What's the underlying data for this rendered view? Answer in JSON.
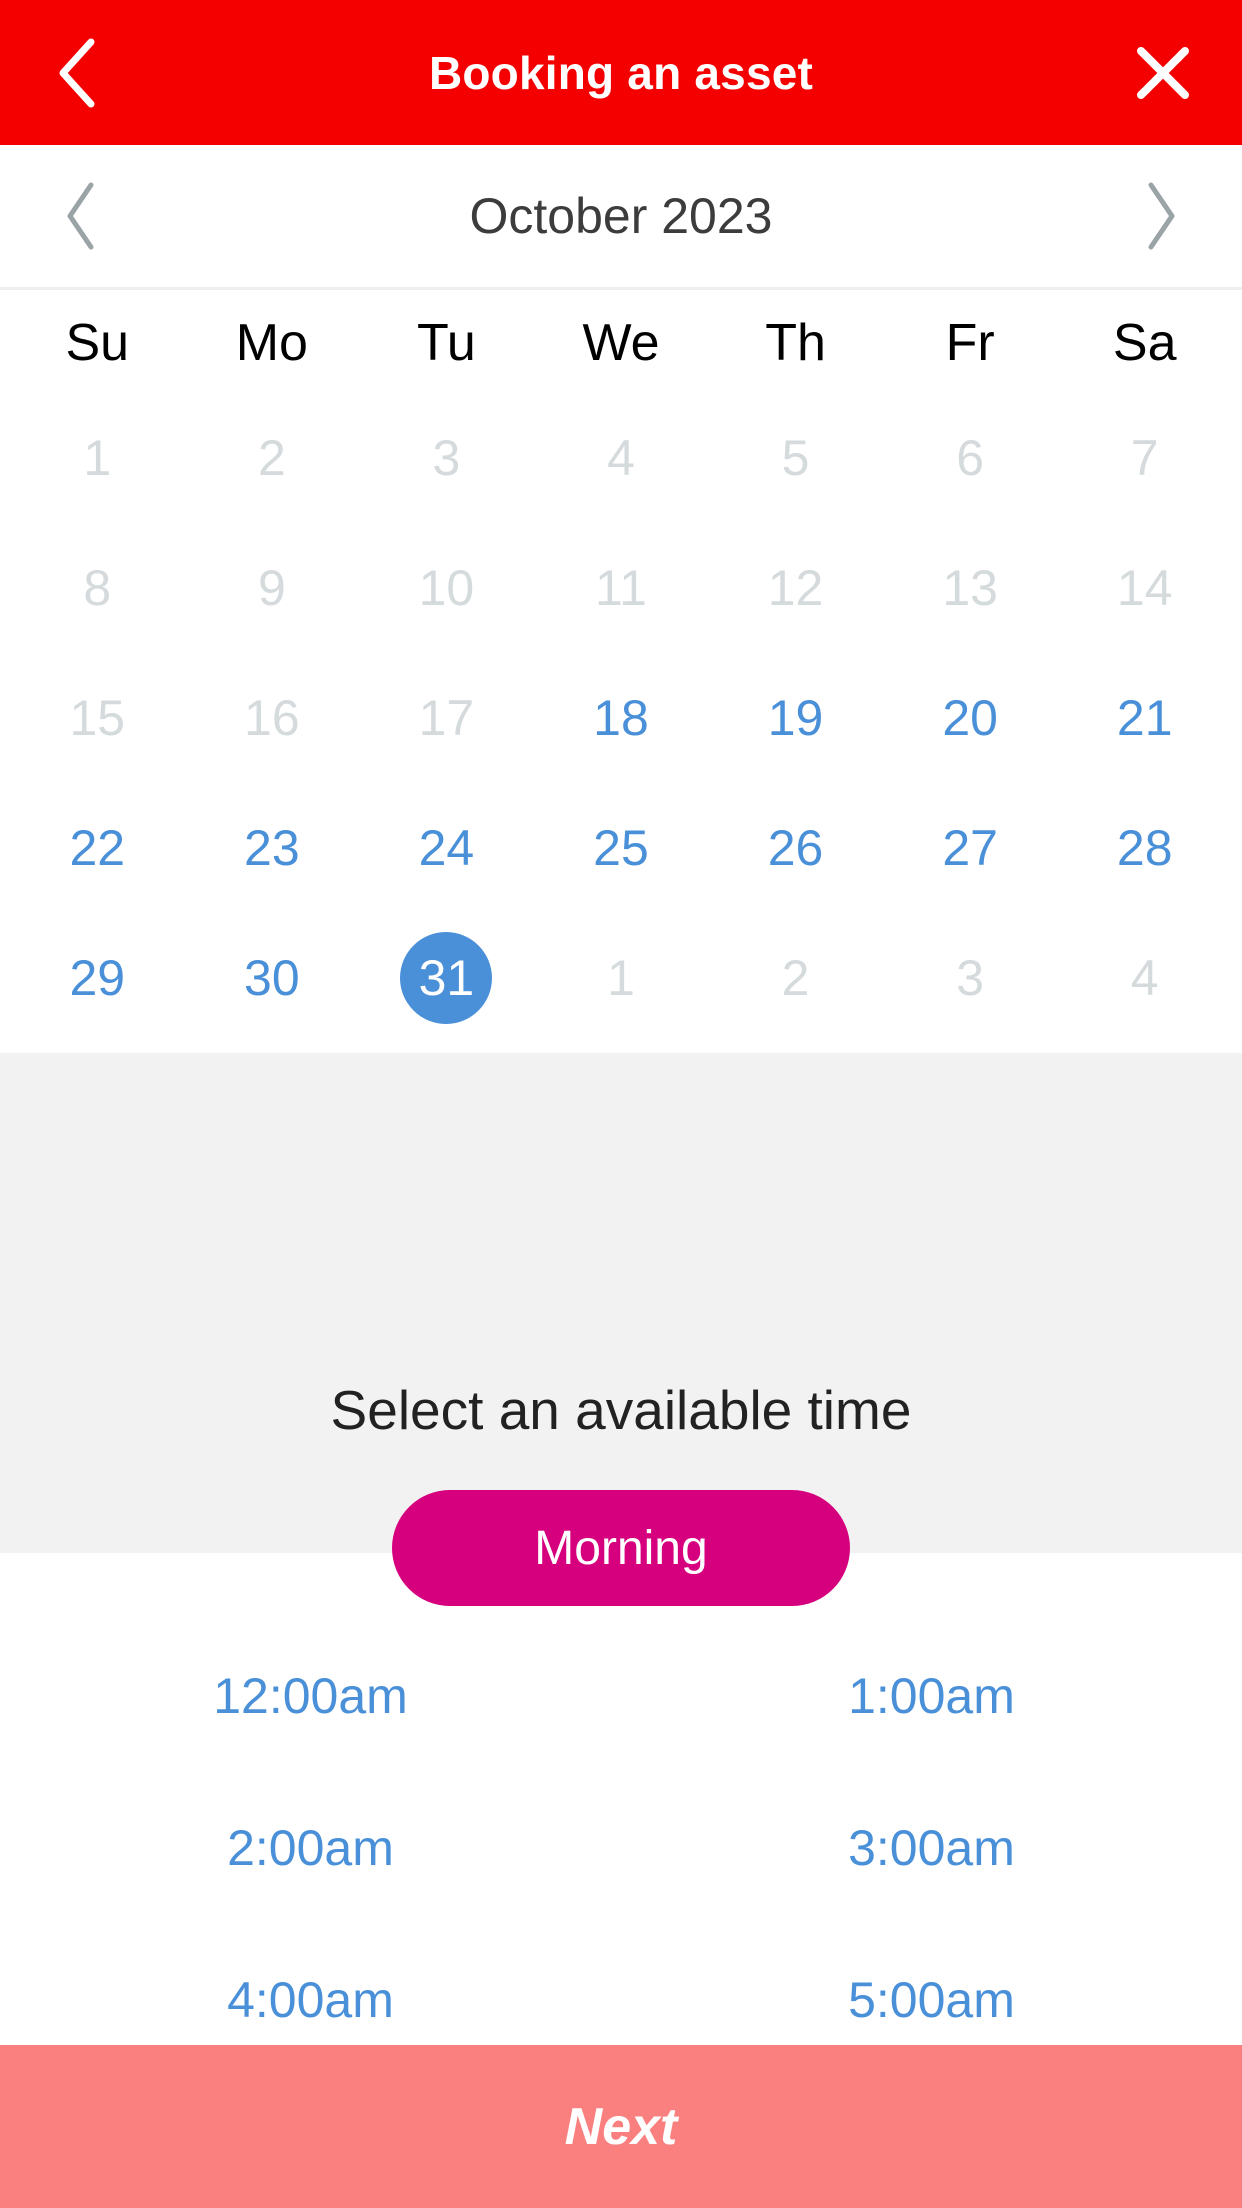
{
  "header": {
    "title": "Booking an asset",
    "back_icon": "chevron-left-icon",
    "close_icon": "close-icon",
    "background_color": "#f50000"
  },
  "month_nav": {
    "label": "October 2023",
    "prev_icon": "chevron-left-icon",
    "next_icon": "chevron-right-icon"
  },
  "calendar": {
    "weekdays": [
      "Su",
      "Mo",
      "Tu",
      "We",
      "Th",
      "Fr",
      "Sa"
    ],
    "selected_day": "31",
    "accent_color": "#4a90d9",
    "disabled_color": "#d5dadc",
    "weeks": [
      [
        {
          "label": "1",
          "state": "disabled"
        },
        {
          "label": "2",
          "state": "disabled"
        },
        {
          "label": "3",
          "state": "disabled"
        },
        {
          "label": "4",
          "state": "disabled"
        },
        {
          "label": "5",
          "state": "disabled"
        },
        {
          "label": "6",
          "state": "disabled"
        },
        {
          "label": "7",
          "state": "disabled"
        }
      ],
      [
        {
          "label": "8",
          "state": "disabled"
        },
        {
          "label": "9",
          "state": "disabled"
        },
        {
          "label": "10",
          "state": "disabled"
        },
        {
          "label": "11",
          "state": "disabled"
        },
        {
          "label": "12",
          "state": "disabled"
        },
        {
          "label": "13",
          "state": "disabled"
        },
        {
          "label": "14",
          "state": "disabled"
        }
      ],
      [
        {
          "label": "15",
          "state": "disabled"
        },
        {
          "label": "16",
          "state": "disabled"
        },
        {
          "label": "17",
          "state": "disabled"
        },
        {
          "label": "18",
          "state": "enabled"
        },
        {
          "label": "19",
          "state": "enabled"
        },
        {
          "label": "20",
          "state": "enabled"
        },
        {
          "label": "21",
          "state": "enabled"
        }
      ],
      [
        {
          "label": "22",
          "state": "enabled"
        },
        {
          "label": "23",
          "state": "enabled"
        },
        {
          "label": "24",
          "state": "enabled"
        },
        {
          "label": "25",
          "state": "enabled"
        },
        {
          "label": "26",
          "state": "enabled"
        },
        {
          "label": "27",
          "state": "enabled"
        },
        {
          "label": "28",
          "state": "enabled"
        }
      ],
      [
        {
          "label": "29",
          "state": "enabled"
        },
        {
          "label": "30",
          "state": "enabled"
        },
        {
          "label": "31",
          "state": "selected"
        },
        {
          "label": "1",
          "state": "disabled"
        },
        {
          "label": "2",
          "state": "disabled"
        },
        {
          "label": "3",
          "state": "disabled"
        },
        {
          "label": "4",
          "state": "disabled"
        }
      ]
    ]
  },
  "time_section": {
    "heading": "Select an available time",
    "period_button": {
      "label": "Morning",
      "color": "#d6007f",
      "selected": true
    },
    "slot_rows": [
      [
        {
          "label": "12:00am"
        },
        {
          "label": "1:00am"
        }
      ],
      [
        {
          "label": "2:00am"
        },
        {
          "label": "3:00am"
        }
      ],
      [
        {
          "label": "4:00am"
        },
        {
          "label": "5:00am"
        }
      ]
    ]
  },
  "footer": {
    "next_label": "Next",
    "color": "#fa8080",
    "enabled": false
  }
}
